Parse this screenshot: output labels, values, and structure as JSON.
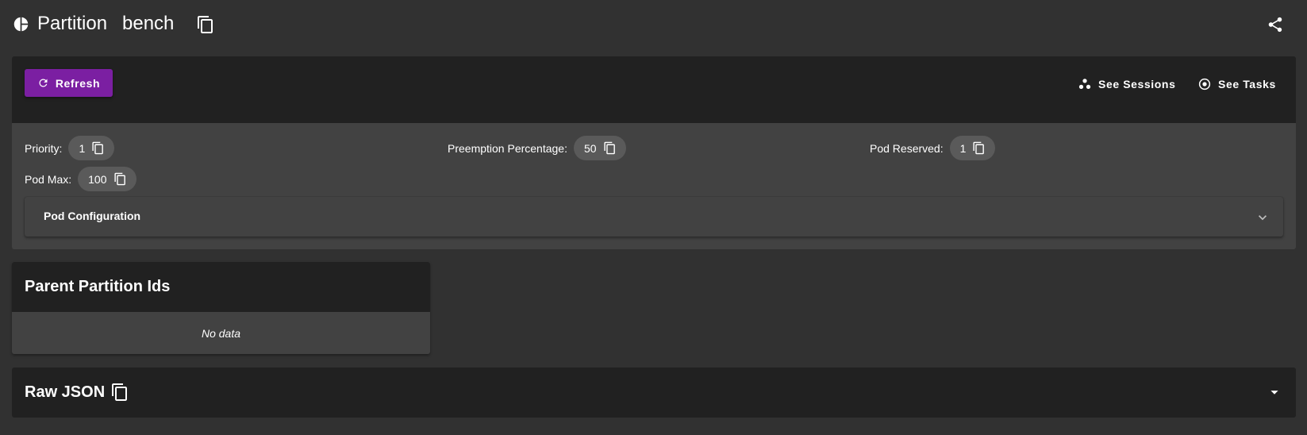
{
  "header": {
    "title": "Partition",
    "id": "bench",
    "icons": {
      "logo": "pie-chart-icon",
      "copy": "copy-icon",
      "share": "share-icon"
    }
  },
  "toolbar": {
    "refresh_label": "Refresh",
    "see_sessions_label": "See Sessions",
    "see_tasks_label": "See Tasks",
    "accent_color": "#7b1fa2"
  },
  "details": {
    "priority": {
      "label": "Priority:",
      "value": "1"
    },
    "preemption_percentage": {
      "label": "Preemption Percentage:",
      "value": "50"
    },
    "pod_reserved": {
      "label": "Pod Reserved:",
      "value": "1"
    },
    "pod_max": {
      "label": "Pod Max:",
      "value": "100"
    },
    "pod_configuration_label": "Pod Configuration"
  },
  "parent_partitions": {
    "title": "Parent Partition Ids",
    "empty_text": "No data"
  },
  "raw_json": {
    "title": "Raw JSON"
  }
}
